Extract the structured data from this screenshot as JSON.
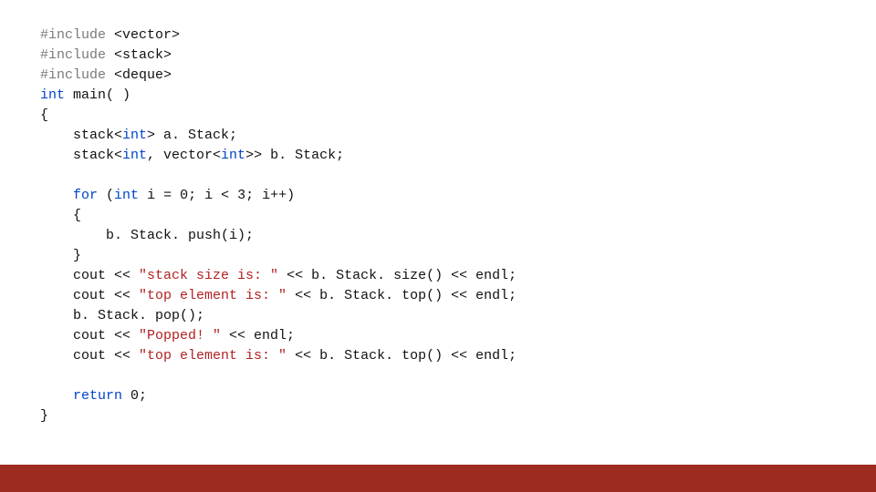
{
  "code": {
    "l01_a": "#include",
    "l01_b": "<vector>",
    "l02_a": "#include",
    "l02_b": "<stack>",
    "l03_a": "#include",
    "l03_b": "<deque>",
    "l04_a": "int",
    "l04_b": " main( )",
    "l05": "{",
    "l06": "    stack<",
    "l06_b": "int",
    "l06_c": "> a. Stack;",
    "l07": "    stack<",
    "l07_b": "int",
    "l07_c": ", vector<",
    "l07_d": "int",
    "l07_e": ">> b. Stack;",
    "l08": "",
    "l09_a": "    ",
    "l09_b": "for",
    "l09_c": " (",
    "l09_d": "int",
    "l09_e": " i = 0; i < 3; i++)",
    "l10": "    {",
    "l11": "        b. Stack. push(i);",
    "l12": "    }",
    "l13_a": "    cout << ",
    "l13_b": "\"stack size is: \"",
    "l13_c": " << b. Stack. size() << endl;",
    "l14_a": "    cout << ",
    "l14_b": "\"top element is: \"",
    "l14_c": " << b. Stack. top() << endl;",
    "l15": "    b. Stack. pop();",
    "l16_a": "    cout << ",
    "l16_b": "\"Popped! \"",
    "l16_c": " << endl;",
    "l17_a": "    cout << ",
    "l17_b": "\"top element is: \"",
    "l17_c": " << b. Stack. top() << endl;",
    "l18": "",
    "l19_a": "    ",
    "l19_b": "return",
    "l19_c": " 0;",
    "l20": "}"
  }
}
